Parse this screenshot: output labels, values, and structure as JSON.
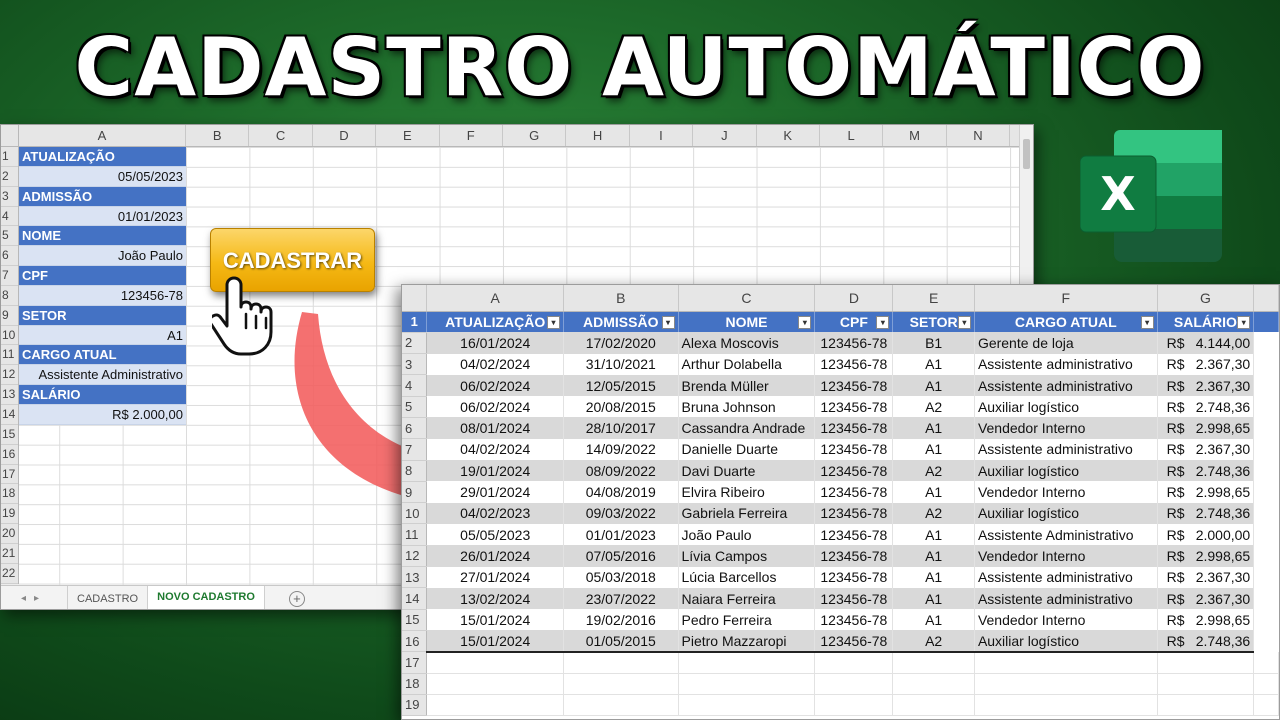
{
  "title": "CADASTRO AUTOMÁTICO",
  "sheet1": {
    "columns": [
      "A",
      "B",
      "C",
      "D",
      "E",
      "F",
      "G",
      "H",
      "I",
      "J",
      "K",
      "L",
      "M",
      "N"
    ],
    "rows": [
      "1",
      "2",
      "3",
      "4",
      "5",
      "6",
      "7",
      "8",
      "9",
      "10",
      "11",
      "12",
      "13",
      "14",
      "15",
      "16",
      "17",
      "18",
      "19",
      "20",
      "21",
      "22"
    ],
    "form": [
      {
        "label": "ATUALIZAÇÃO",
        "value": "05/05/2023"
      },
      {
        "label": "ADMISSÃO",
        "value": "01/01/2023"
      },
      {
        "label": "NOME",
        "value": "João Paulo"
      },
      {
        "label": "CPF",
        "value": "123456-78"
      },
      {
        "label": "SETOR",
        "value": "A1"
      },
      {
        "label": "CARGO ATUAL",
        "value": "Assistente Administrativo"
      },
      {
        "label": "SALÁRIO",
        "value": "R$ 2.000,00"
      }
    ],
    "tabs": [
      "CADASTRO",
      "NOVO CADASTRO"
    ],
    "active_tab": "NOVO CADASTRO"
  },
  "button": {
    "label": "CADASTRAR"
  },
  "logo": {
    "letter": "X"
  },
  "sheet2": {
    "columns": [
      "A",
      "B",
      "C",
      "D",
      "E",
      "F",
      "G"
    ],
    "headers": [
      "ATUALIZAÇÃO",
      "ADMISSÃO",
      "NOME",
      "CPF",
      "SETOR",
      "CARGO ATUAL",
      "SALÁRIO"
    ],
    "row_numbers": [
      "1",
      "2",
      "3",
      "4",
      "5",
      "6",
      "7",
      "8",
      "9",
      "10",
      "11",
      "12",
      "13",
      "14",
      "15",
      "16",
      "17",
      "18",
      "19"
    ],
    "currency": "R$",
    "rows": [
      [
        "16/01/2024",
        "17/02/2020",
        "Alexa Moscovis",
        "123456-78",
        "B1",
        "Gerente de loja",
        "4.144,00"
      ],
      [
        "04/02/2024",
        "31/10/2021",
        "Arthur Dolabella",
        "123456-78",
        "A1",
        "Assistente administrativo",
        "2.367,30"
      ],
      [
        "06/02/2024",
        "12/05/2015",
        "Brenda Müller",
        "123456-78",
        "A1",
        "Assistente administrativo",
        "2.367,30"
      ],
      [
        "06/02/2024",
        "20/08/2015",
        "Bruna Johnson",
        "123456-78",
        "A2",
        "Auxiliar logístico",
        "2.748,36"
      ],
      [
        "08/01/2024",
        "28/10/2017",
        "Cassandra Andrade",
        "123456-78",
        "A1",
        "Vendedor Interno",
        "2.998,65"
      ],
      [
        "04/02/2024",
        "14/09/2022",
        "Danielle Duarte",
        "123456-78",
        "A1",
        "Assistente administrativo",
        "2.367,30"
      ],
      [
        "19/01/2024",
        "08/09/2022",
        "Davi Duarte",
        "123456-78",
        "A2",
        "Auxiliar logístico",
        "2.748,36"
      ],
      [
        "29/01/2024",
        "04/08/2019",
        "Elvira Ribeiro",
        "123456-78",
        "A1",
        "Vendedor Interno",
        "2.998,65"
      ],
      [
        "04/02/2023",
        "09/03/2022",
        "Gabriela Ferreira",
        "123456-78",
        "A2",
        "Auxiliar logístico",
        "2.748,36"
      ],
      [
        "05/05/2023",
        "01/01/2023",
        "João Paulo",
        "123456-78",
        "A1",
        "Assistente Administrativo",
        "2.000,00"
      ],
      [
        "26/01/2024",
        "07/05/2016",
        "Lívia Campos",
        "123456-78",
        "A1",
        "Vendedor Interno",
        "2.998,65"
      ],
      [
        "27/01/2024",
        "05/03/2018",
        "Lúcia Barcellos",
        "123456-78",
        "A1",
        "Assistente administrativo",
        "2.367,30"
      ],
      [
        "13/02/2024",
        "23/07/2022",
        "Naiara Ferreira",
        "123456-78",
        "A1",
        "Assistente administrativo",
        "2.367,30"
      ],
      [
        "15/01/2024",
        "19/02/2016",
        "Pedro Ferreira",
        "123456-78",
        "A1",
        "Vendedor Interno",
        "2.998,65"
      ],
      [
        "15/01/2024",
        "01/05/2015",
        "Pietro Mazzaropi",
        "123456-78",
        "A2",
        "Auxiliar logístico",
        "2.748,36"
      ]
    ]
  },
  "colors": {
    "header_blue": "#4472c4",
    "form_value_bg": "#dae3f3",
    "band_gray": "#d9d9d9",
    "button_yellow": "#f5b915",
    "arrow_red": "#f25c5c",
    "excel_green": "#1e7a2f"
  }
}
